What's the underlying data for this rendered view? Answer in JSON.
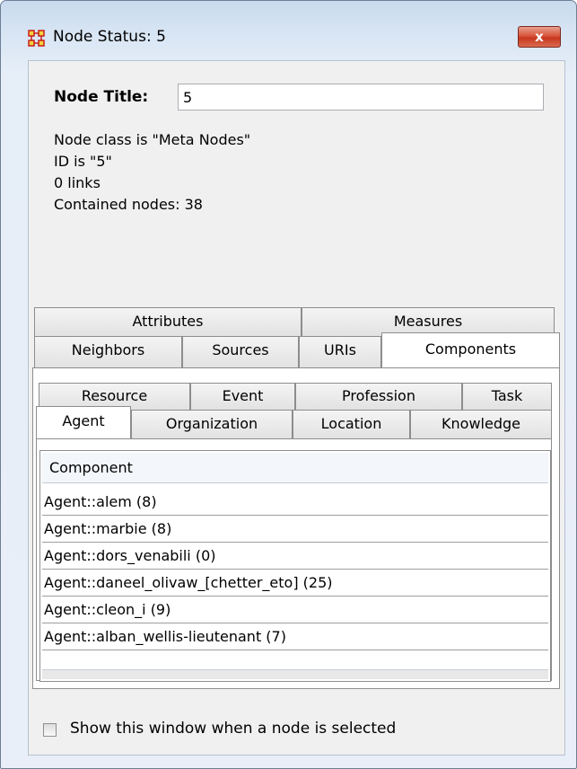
{
  "window": {
    "title": "Node Status: 5",
    "close_label": "x"
  },
  "node": {
    "title_label": "Node Title:",
    "title_value": "5",
    "info": [
      "Node class is \"Meta Nodes\"",
      "ID is \"5\"",
      "0 links",
      "Contained nodes: 38"
    ]
  },
  "outer_tabs": {
    "row1": [
      "Attributes",
      "Measures"
    ],
    "row2": [
      "Neighbors",
      "Sources",
      "URIs",
      "Components"
    ],
    "selected": "Components"
  },
  "inner_tabs": {
    "row1": [
      "Resource",
      "Event",
      "Profession",
      "Task"
    ],
    "row2": [
      "Agent",
      "Organization",
      "Location",
      "Knowledge"
    ],
    "selected": "Agent"
  },
  "table": {
    "header": "Component",
    "rows": [
      "Agent::alem (8)",
      "Agent::marbie (8)",
      "Agent::dors_venabili (0)",
      "Agent::daneel_olivaw_[chetter_eto] (25)",
      "Agent::cleon_i (9)",
      "Agent::alban_wellis-lieutenant (7)"
    ]
  },
  "footer": {
    "checkbox_label": "Show this window when a node is selected",
    "checked": false
  },
  "colors": {
    "close": "#c7371e",
    "frame": "#d9e6f4"
  }
}
